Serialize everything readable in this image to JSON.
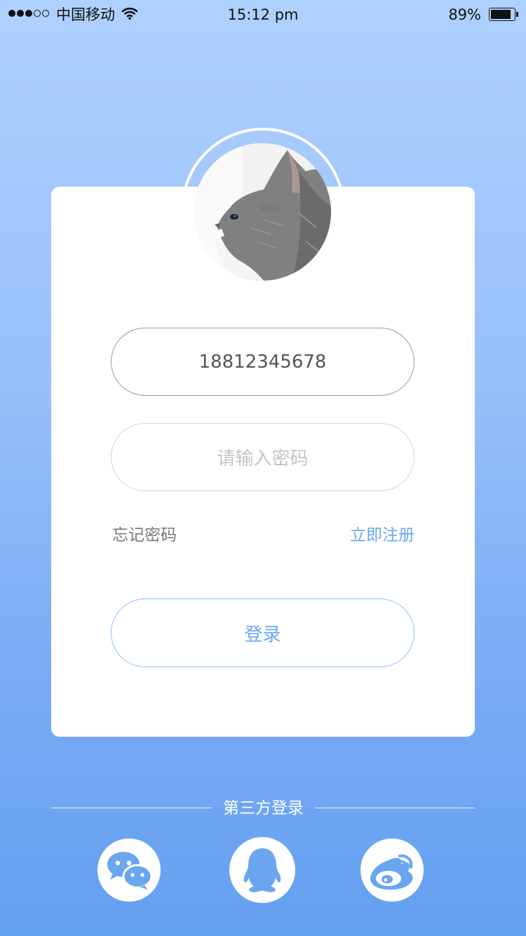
{
  "status_bar": {
    "signal_filled": 3,
    "signal_empty": 2,
    "carrier": "中国移动",
    "wifi_icon": "wifi-icon",
    "time": "15:12 pm",
    "battery_percent_text": "89%",
    "battery_level": 0.89
  },
  "profile": {
    "avatar_icon": "cat-avatar-image"
  },
  "login_form": {
    "phone_value": "18812345678",
    "password_placeholder": "请输入密码",
    "forgot_password": "忘记密码",
    "register": "立即注册",
    "login_button": "登录"
  },
  "third_party": {
    "label": "第三方登录",
    "providers": [
      {
        "name": "wechat",
        "icon": "wechat-icon"
      },
      {
        "name": "qq",
        "icon": "qq-icon"
      },
      {
        "name": "weibo",
        "icon": "weibo-icon"
      }
    ]
  },
  "colors": {
    "background_top": "#afd1fe",
    "background_bottom": "#64a0f1",
    "accent": "#6aa6f0",
    "card": "#ffffff"
  }
}
